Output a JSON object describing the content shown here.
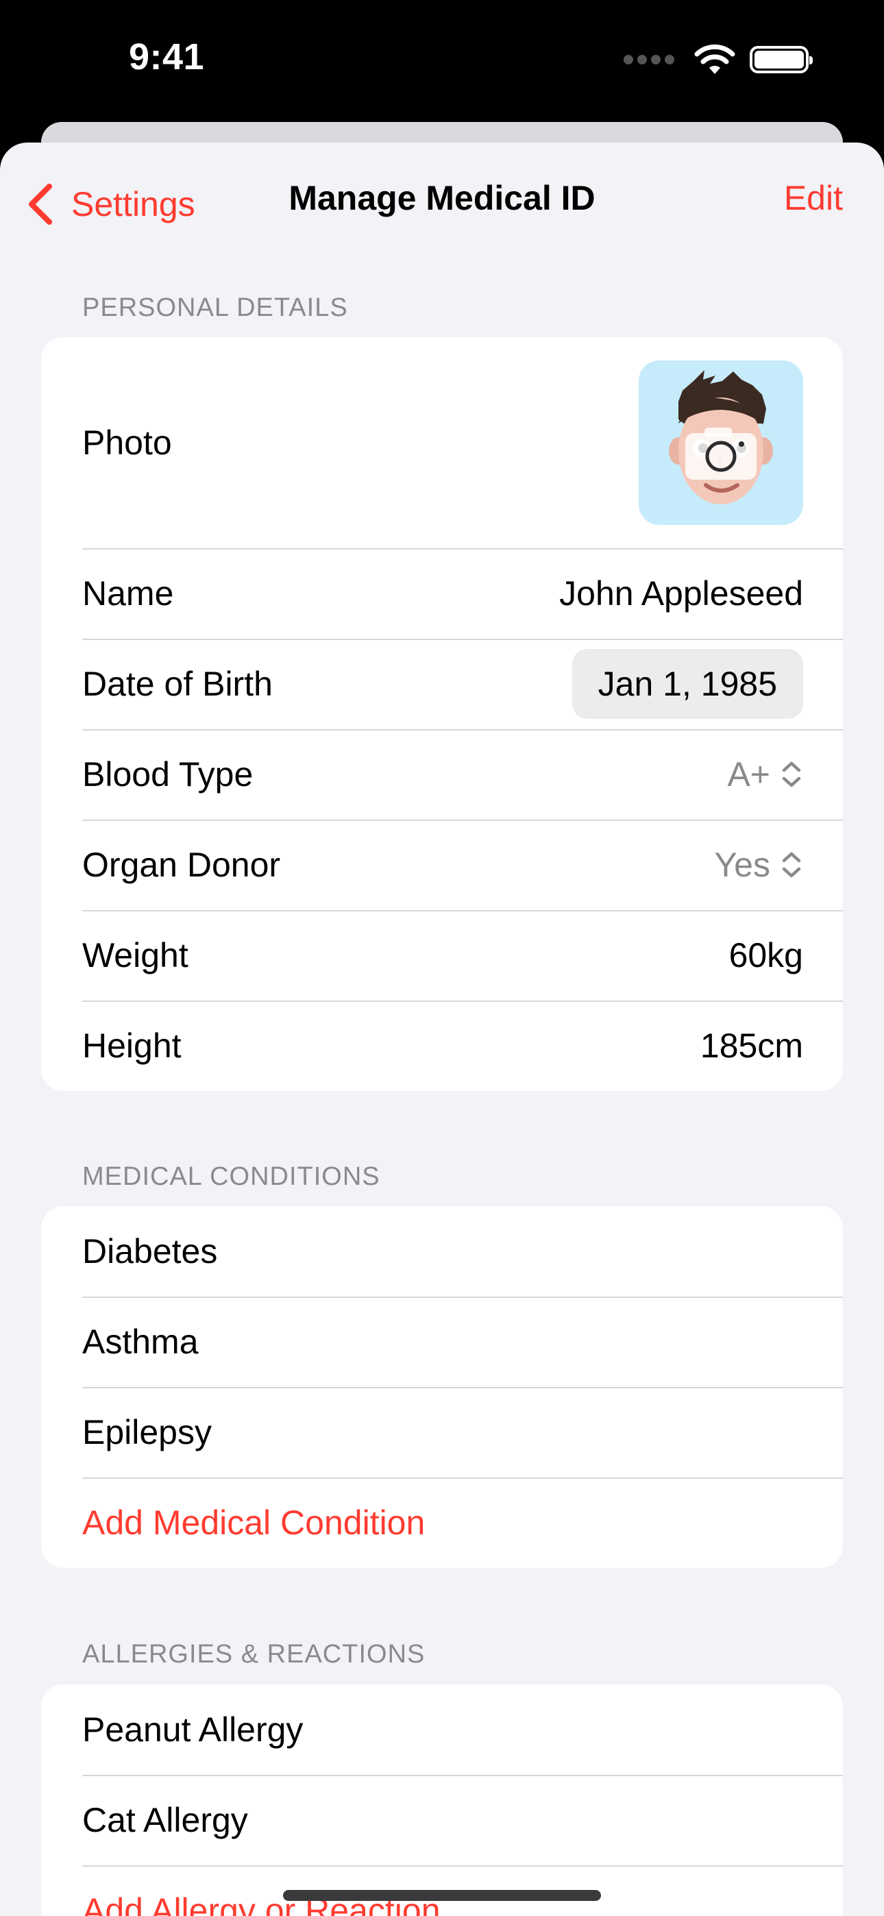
{
  "status_bar": {
    "time": "9:41"
  },
  "nav": {
    "back_label": "Settings",
    "title": "Manage Medical ID",
    "edit_label": "Edit"
  },
  "personal": {
    "header": "PERSONAL DETAILS",
    "photo_label": "Photo",
    "name_label": "Name",
    "name_value": "John Appleseed",
    "dob_label": "Date of Birth",
    "dob_value": "Jan 1, 1985",
    "blood_label": "Blood Type",
    "blood_value": "A+",
    "donor_label": "Organ Donor",
    "donor_value": "Yes",
    "weight_label": "Weight",
    "weight_value": "60kg",
    "height_label": "Height",
    "height_value": "185cm"
  },
  "conditions": {
    "header": "MEDICAL CONDITIONS",
    "items": [
      "Diabetes",
      "Asthma",
      "Epilepsy"
    ],
    "add_label": "Add Medical Condition"
  },
  "allergies": {
    "header": "ALLERGIES & REACTIONS",
    "items": [
      "Peanut Allergy",
      "Cat Allergy"
    ],
    "add_label": "Add Allergy or Reaction"
  },
  "colors": {
    "accent": "#ff3b30",
    "background": "#f2f2f7",
    "card": "#ffffff",
    "secondary_text": "#8a8a8e",
    "photo_background": "#c6ebfb"
  },
  "icons": {
    "back": "chevron-left-icon",
    "stepper": "chevron-up-down-icon",
    "photo": "memoji-avatar",
    "camera": "camera-icon"
  }
}
